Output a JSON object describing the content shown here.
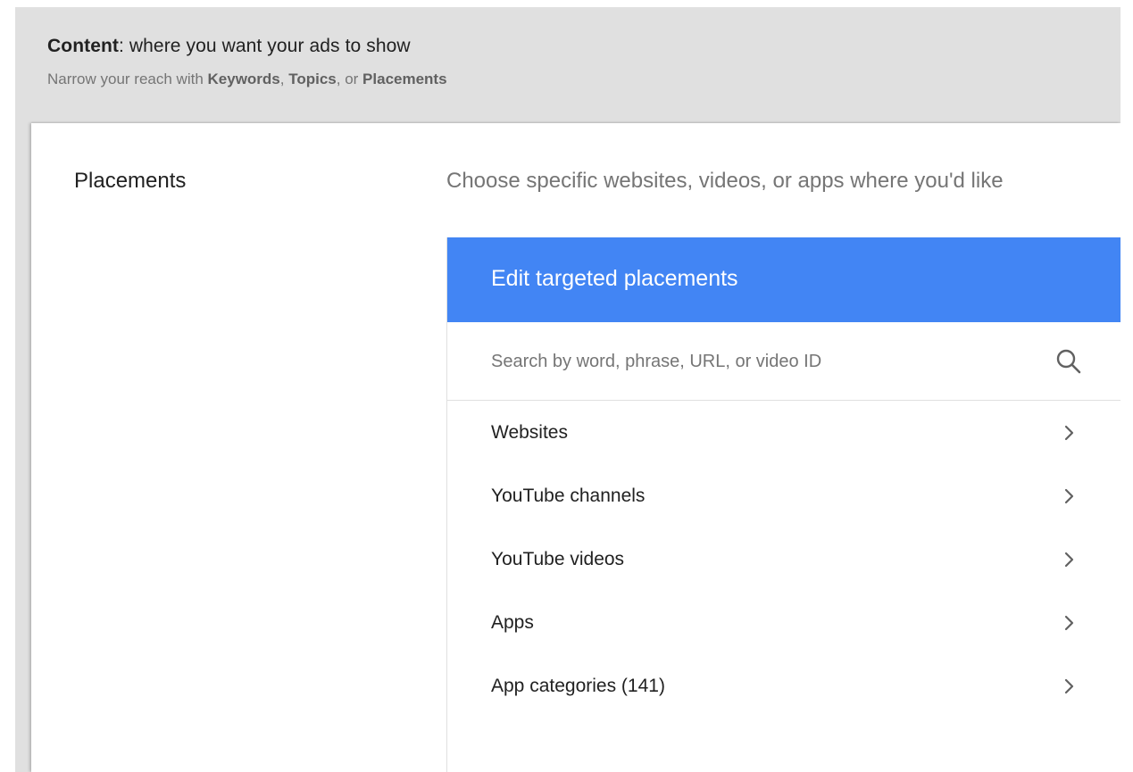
{
  "header": {
    "title_bold": "Content",
    "title_rest": ": where you want your ads to show",
    "subtitle_prefix": "Narrow your reach with ",
    "subtitle_keywords": "Keywords",
    "subtitle_sep1": ", ",
    "subtitle_topics": "Topics",
    "subtitle_sep2": ", or ",
    "subtitle_placements": "Placements"
  },
  "section": {
    "label": "Placements",
    "description": "Choose specific websites, videos, or apps where you'd like"
  },
  "picker": {
    "title": "Edit targeted placements",
    "search_placeholder": "Search by word, phrase, URL, or video ID",
    "items": [
      {
        "label": "Websites"
      },
      {
        "label": "YouTube channels"
      },
      {
        "label": "YouTube videos"
      },
      {
        "label": "Apps"
      },
      {
        "label": "App categories (141)"
      }
    ]
  },
  "colors": {
    "header_bg": "#4285f4",
    "panel_bg": "#e0e0e0"
  },
  "icons": {
    "search": "search-icon",
    "chevron": "chevron-right-icon"
  }
}
